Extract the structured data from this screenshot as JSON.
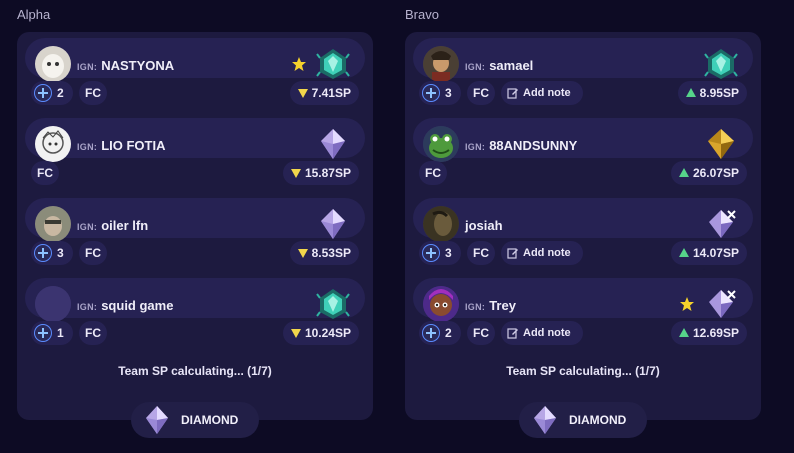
{
  "colors": {
    "background": "#0d0b24",
    "card": "#1d1a3f",
    "chip": "#262253",
    "sp_down": "#f1d64b",
    "sp_up": "#56d48a",
    "star": "#f5d22c"
  },
  "ign_tag": "IGN:",
  "teams": [
    {
      "name": "Alpha",
      "team_sp": "Team SP calculating... (1/7)",
      "tier": "DIAMOND",
      "tier_icon": "diamond-rank-icon",
      "players": [
        {
          "ign": "NASTYONA",
          "show_tag": true,
          "avatar": "ghost-avatar",
          "starred": true,
          "rank_icon": "ascendant-rank-icon",
          "party": "2",
          "fc": "FC",
          "note": "",
          "sp": "7.41SP",
          "sp_dir": "down"
        },
        {
          "ign": "LIO FOTIA",
          "show_tag": true,
          "avatar": "sketch-avatar",
          "starred": false,
          "rank_icon": "diamond-rank-icon",
          "party": "",
          "fc": "FC",
          "note": "",
          "sp": "15.87SP",
          "sp_dir": "down"
        },
        {
          "ign": "oiler lfn",
          "show_tag": true,
          "avatar": "photo-avatar",
          "starred": false,
          "rank_icon": "diamond-rank-icon",
          "party": "3",
          "fc": "FC",
          "note": "",
          "sp": "8.53SP",
          "sp_dir": "down"
        },
        {
          "ign": "squid game",
          "show_tag": true,
          "avatar": "blank-avatar",
          "starred": false,
          "rank_icon": "ascendant-rank-icon",
          "party": "1",
          "fc": "FC",
          "note": "",
          "sp": "10.24SP",
          "sp_dir": "down"
        }
      ]
    },
    {
      "name": "Bravo",
      "team_sp": "Team SP calculating... (1/7)",
      "tier": "DIAMOND",
      "tier_icon": "diamond-rank-icon",
      "players": [
        {
          "ign": "samael",
          "show_tag": true,
          "avatar": "character-avatar",
          "starred": false,
          "rank_icon": "ascendant-rank-icon",
          "party": "3",
          "fc": "FC",
          "note": "Add note",
          "sp": "8.95SP",
          "sp_dir": "up"
        },
        {
          "ign": "88ANDSUNNY",
          "show_tag": true,
          "avatar": "frog-avatar",
          "starred": false,
          "rank_icon": "gold-rank-icon",
          "party": "",
          "fc": "FC",
          "note": "",
          "sp": "26.07SP",
          "sp_dir": "up"
        },
        {
          "ign": "josiah",
          "show_tag": false,
          "avatar": "dark-photo-avatar",
          "starred": false,
          "rank_icon": "crossed-diamond-rank-icon",
          "party": "3",
          "fc": "FC",
          "note": "Add note",
          "sp": "14.07SP",
          "sp_dir": "up"
        },
        {
          "ign": "Trey",
          "show_tag": true,
          "avatar": "cartoon-avatar",
          "starred": true,
          "rank_icon": "crossed-diamond-rank-icon",
          "party": "2",
          "fc": "FC",
          "note": "Add note",
          "sp": "12.69SP",
          "sp_dir": "up"
        }
      ]
    }
  ]
}
